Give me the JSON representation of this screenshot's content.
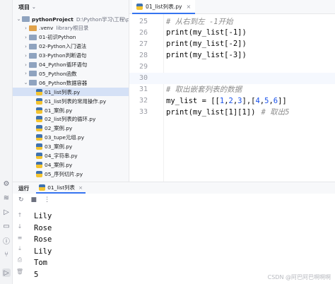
{
  "project_panel": {
    "title": "项目",
    "tree": [
      {
        "label": "pythonProject",
        "path": "D:\\Python学习\\工程\\pythonPr",
        "type": "root",
        "expanded": true
      },
      {
        "label": ".venv",
        "note": "library根目录",
        "type": "venv"
      },
      {
        "label": "01-初识Python",
        "type": "folder"
      },
      {
        "label": "02-Python入门语法",
        "type": "folder"
      },
      {
        "label": "03-Python判断语句",
        "type": "folder"
      },
      {
        "label": "04_Python循环语句",
        "type": "folder"
      },
      {
        "label": "05_Python函数",
        "type": "folder"
      },
      {
        "label": "06_Python数据容器",
        "type": "folder",
        "expanded": true
      },
      {
        "label": "01_list列表.py",
        "type": "py",
        "selected": true
      },
      {
        "label": "01_list列表的常用操作.py",
        "type": "py"
      },
      {
        "label": "01_案例.py",
        "type": "py"
      },
      {
        "label": "02_list列表的循环.py",
        "type": "py"
      },
      {
        "label": "02_案例.py",
        "type": "py"
      },
      {
        "label": "03_tupe元组.py",
        "type": "py"
      },
      {
        "label": "03_案例.py",
        "type": "py"
      },
      {
        "label": "04_字符串.py",
        "type": "py"
      },
      {
        "label": "04_案例.py",
        "type": "py"
      },
      {
        "label": "05_序列切片.py",
        "type": "py"
      }
    ]
  },
  "editor": {
    "tab_label": "01_list列表.py",
    "lines": [
      {
        "num": "25",
        "kind": "comment",
        "text": "# 从右到左 -1开始"
      },
      {
        "num": "26",
        "kind": "code",
        "text": "print(my_list[-1])"
      },
      {
        "num": "27",
        "kind": "code",
        "text": "print(my_list[-2])"
      },
      {
        "num": "28",
        "kind": "code",
        "text": "print(my_list[-3])"
      },
      {
        "num": "29",
        "kind": "blank",
        "text": ""
      },
      {
        "num": "30",
        "kind": "blank",
        "text": "",
        "current": true
      },
      {
        "num": "31",
        "kind": "comment",
        "text": "# 取出嵌套列表的数据"
      },
      {
        "num": "32",
        "kind": "nested",
        "text": "my_list = [[1,2,3],[4,5,6]]"
      },
      {
        "num": "33",
        "kind": "hinted",
        "text": "print(my_list[1][1])",
        "hint": "# 取出5"
      }
    ]
  },
  "run_panel": {
    "title": "运行",
    "tab_label": "01_list列表",
    "output": [
      "Lily",
      "Rose",
      "Rose",
      "Lily",
      "Tom",
      "5"
    ]
  },
  "watermark": "CSDN @阿巴阿巴啊啊啊"
}
